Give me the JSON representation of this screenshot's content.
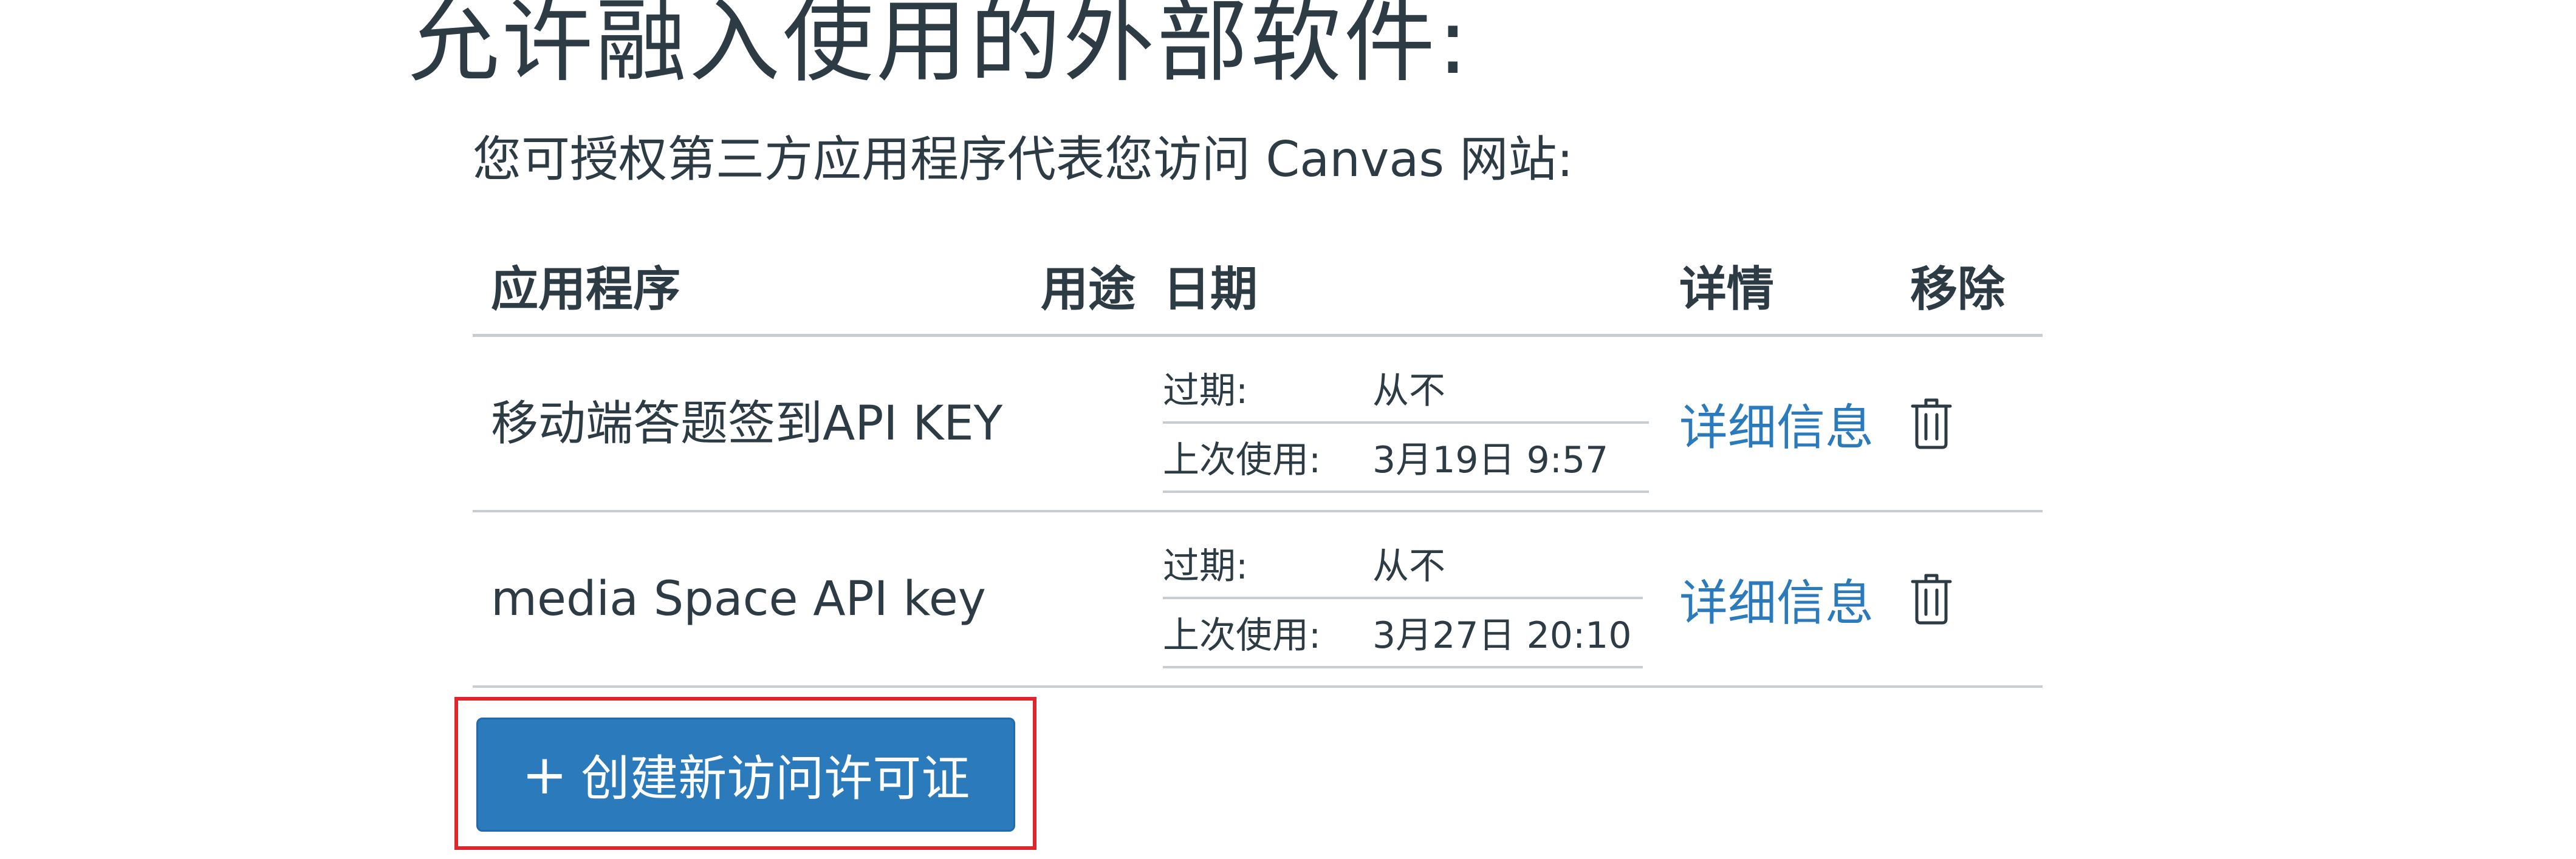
{
  "page": {
    "heading": "允许融入使用的外部软件:",
    "intro": "您可授权第三方应用程序代表您访问 Canvas 网站:"
  },
  "table": {
    "headers": {
      "app": "应用程序",
      "purpose": "用途",
      "date": "日期",
      "details": "详情",
      "remove": "移除"
    },
    "rows": [
      {
        "app": "移动端答题签到API KEY",
        "expires_label": "过期:",
        "expires_value": "从不",
        "last_used_label": "上次使用:",
        "last_used_value": "3月19日 9:57",
        "details_link": "详细信息",
        "remove_icon": "trash-icon"
      },
      {
        "app": "media Space API key",
        "expires_label": "过期:",
        "expires_value": "从不",
        "last_used_label": "上次使用:",
        "last_used_value": "3月27日 20:10",
        "details_link": "详细信息",
        "remove_icon": "trash-icon"
      }
    ]
  },
  "actions": {
    "create_token_icon": "plus-icon",
    "create_token_label": "创建新访问许可证"
  },
  "colors": {
    "text": "#2d3b45",
    "link": "#2b7abc",
    "button_bg": "#2b7abc",
    "divider": "#c7cdd1",
    "highlight_border": "#e0262c"
  }
}
